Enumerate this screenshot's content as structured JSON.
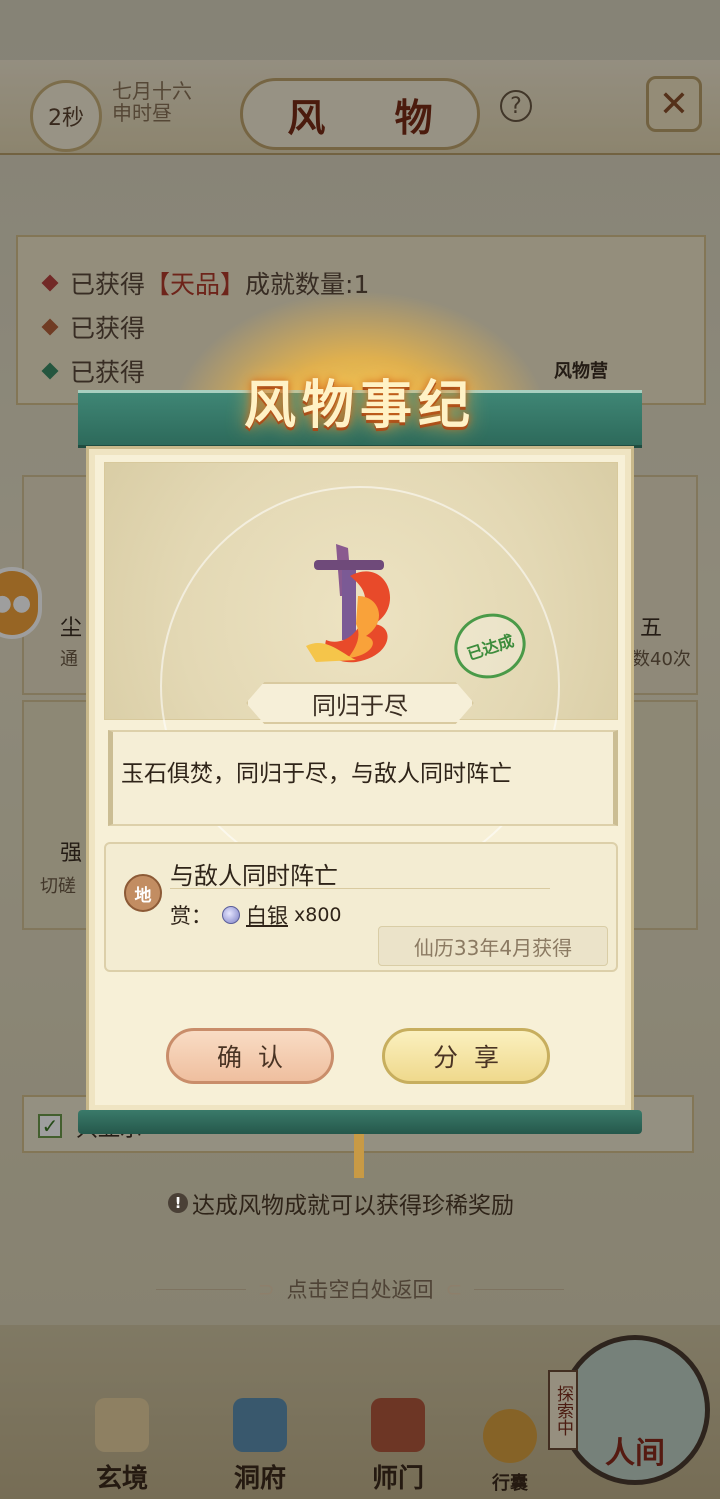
{
  "header": {
    "timer": "2秒",
    "lunar_date": "七月十六",
    "time_period": "申时昼",
    "title": "风 物",
    "help_icon": "question-icon",
    "close_icon": "crossed-swords-icon"
  },
  "stats": {
    "line1_prefix": "已获得",
    "line1_grade": "【天品】",
    "line1_suffix": "成就数量:1",
    "line2_prefix": "已获得",
    "line3_prefix": "已获得",
    "mascot_label": "风物营"
  },
  "background_cards": {
    "left_title": "尘",
    "left_sub": "通",
    "right_title": "五",
    "right_sub": "数40次",
    "card2_title": "强",
    "card2_sub": "切磋",
    "checkbox_label": "只显示"
  },
  "modal": {
    "banner_title": "风物事纪",
    "achievement_name": "同归于尽",
    "stamp_text": "已达成",
    "description": "玉石俱焚，同归于尽，与敌人同时阵亡",
    "reward": {
      "grade_badge": "地",
      "title": "与敌人同时阵亡",
      "reward_prefix": "赏：",
      "item_name": "白银",
      "item_qty": "x800",
      "item_icon": "silver-coin-icon",
      "obtained": "仙历33年4月获得"
    },
    "confirm_label": "确认",
    "share_label": "分享"
  },
  "hint": "达成风物成就可以获得珍稀奖励",
  "tap_back": "点击空白处返回",
  "nav": {
    "xuanjing": "玄境",
    "dongfu": "洞府",
    "shimen": "师门",
    "xinshi": "行囊",
    "renjian": "人间",
    "explore_tag": "探索中"
  },
  "colors": {
    "banner_green": "#2d6a5b",
    "title_red": "#7a2c16",
    "confirm_bg": "#efbf9f",
    "share_bg": "#efd98d",
    "stamp_green": "#3d8c3c"
  }
}
